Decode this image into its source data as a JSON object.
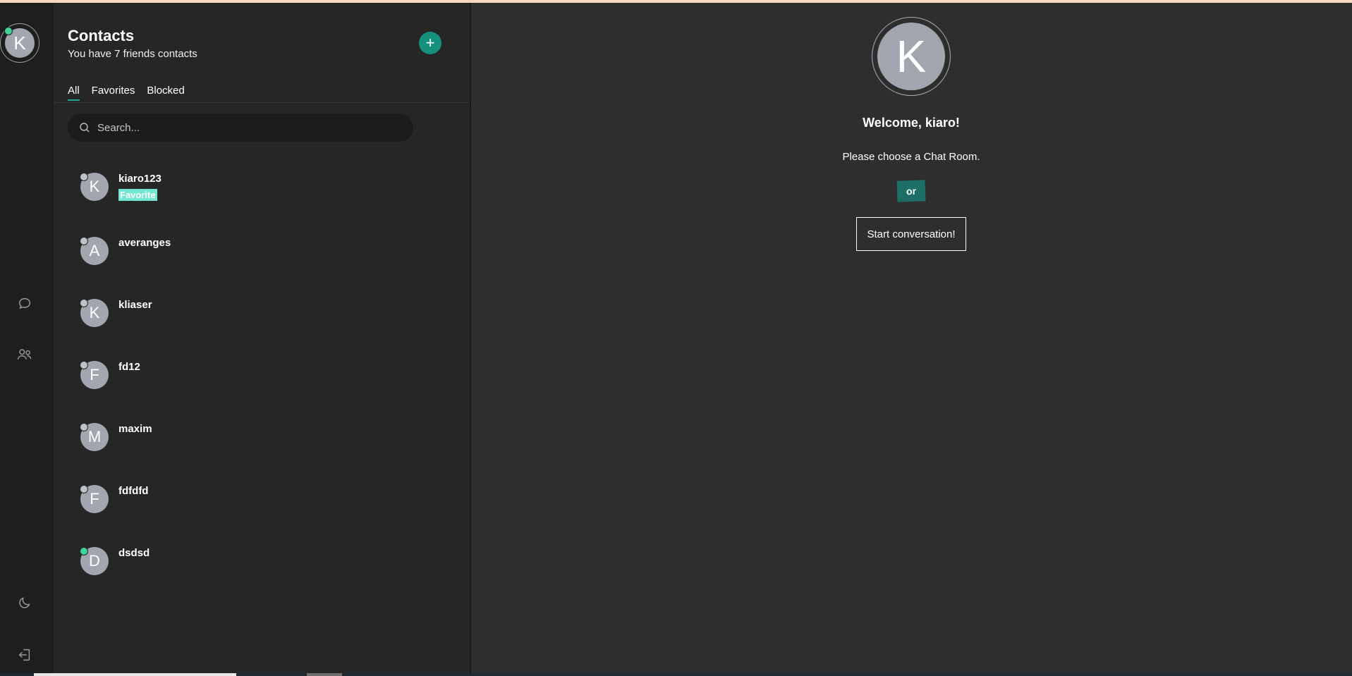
{
  "user": {
    "initial": "K",
    "status": "online"
  },
  "rail": {
    "icons": [
      "chat-icon",
      "contacts-icon",
      "moon-icon",
      "logout-icon"
    ]
  },
  "contacts_panel": {
    "title": "Contacts",
    "subtitle": "You have 7 friends contacts",
    "add_label": "+",
    "tabs": [
      {
        "label": "All",
        "active": true
      },
      {
        "label": "Favorites",
        "active": false
      },
      {
        "label": "Blocked",
        "active": false
      }
    ],
    "search_placeholder": "Search...",
    "contacts": [
      {
        "initial": "K",
        "name": "kiaro123",
        "badge": "Favorite",
        "status": "offline"
      },
      {
        "initial": "A",
        "name": "averanges",
        "badge": "",
        "status": "offline"
      },
      {
        "initial": "K",
        "name": "kliaser",
        "badge": "",
        "status": "offline"
      },
      {
        "initial": "F",
        "name": "fd12",
        "badge": "",
        "status": "offline"
      },
      {
        "initial": "M",
        "name": "maxim",
        "badge": "",
        "status": "offline"
      },
      {
        "initial": "F",
        "name": "fdfdfd",
        "badge": "",
        "status": "offline"
      },
      {
        "initial": "D",
        "name": "dsdsd",
        "badge": "",
        "status": "online"
      }
    ]
  },
  "main": {
    "avatar_initial": "K",
    "welcome": "Welcome, kiaro!",
    "choose": "Please choose a Chat Room.",
    "or_label": "or",
    "start_label": "Start conversation!"
  },
  "colors": {
    "accent": "#14907c",
    "online": "#3ed49a",
    "favorite_badge": "#72e6d1"
  }
}
